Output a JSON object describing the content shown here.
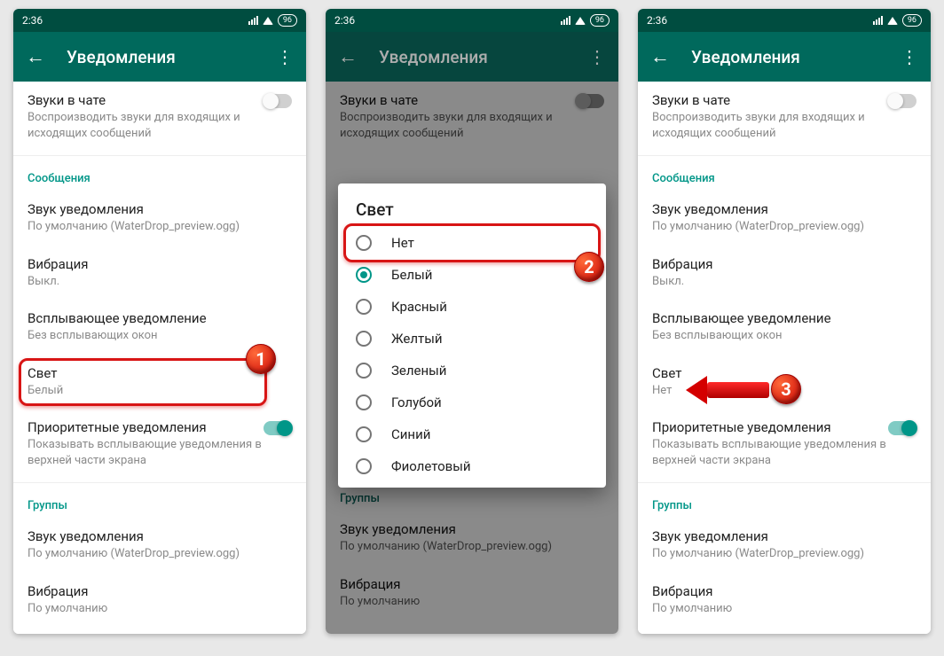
{
  "status": {
    "time": "2:36",
    "battery": "96"
  },
  "appbar": {
    "title": "Уведомления"
  },
  "chat_sounds": {
    "title": "Звуки в чате",
    "sub": "Воспроизводить звуки для входящих и исходящих сообщений"
  },
  "sections": {
    "messages": "Сообщения",
    "groups": "Группы"
  },
  "items": {
    "notif_sound": {
      "title": "Звук уведомления",
      "sub": "По умолчанию (WaterDrop_preview.ogg)"
    },
    "vibration": {
      "title": "Вибрация",
      "sub_off": "Выкл.",
      "sub_default": "По умолчанию"
    },
    "popup": {
      "title": "Всплывающее уведомление",
      "sub": "Без всплывающих окон"
    },
    "light": {
      "title": "Свет",
      "sub_white": "Белый",
      "sub_none": "Нет"
    },
    "priority": {
      "title": "Приоритетные уведомления",
      "sub": "Показывать всплывающие уведомления в верхней части экрана"
    }
  },
  "dialog": {
    "title": "Свет",
    "options": [
      "Нет",
      "Белый",
      "Красный",
      "Желтый",
      "Зеленый",
      "Голубой",
      "Синий",
      "Фиолетовый"
    ],
    "selected_index": 1
  },
  "badges": {
    "one": "1",
    "two": "2",
    "three": "3"
  }
}
